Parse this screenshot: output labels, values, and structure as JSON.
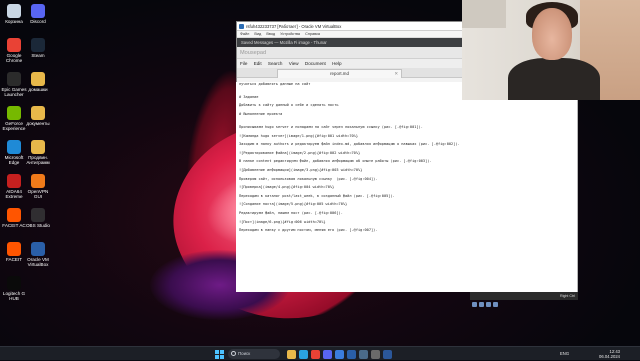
{
  "desktop_icons": [
    {
      "label": "Корзина",
      "color": "#c9d6e4"
    },
    {
      "label": "Discord",
      "color": "#5865f2"
    },
    {
      "label": "Google Chrome",
      "color": "#e94235"
    },
    {
      "label": "Steam",
      "color": "#1b2838"
    },
    {
      "label": "Epic Games Launcher",
      "color": "#2b2b2b"
    },
    {
      "label": "домашки",
      "color": "#e8b84a"
    },
    {
      "label": "GeForce Experience",
      "color": "#76b900"
    },
    {
      "label": "документы",
      "color": "#e8b84a"
    },
    {
      "label": "Microsoft Edge",
      "color": "#1f8ad6"
    },
    {
      "label": "Продвин. Антиграмм",
      "color": "#e8b84a"
    },
    {
      "label": "AIDA64 Extreme",
      "color": "#c6201f"
    },
    {
      "label": "OpenVPN GUI",
      "color": "#f07a1a"
    },
    {
      "label": "FACEIT AC",
      "color": "#ff5500"
    },
    {
      "label": "OBS Studio",
      "color": "#302e31"
    },
    {
      "label": "FACEIT",
      "color": "#ff5500"
    },
    {
      "label": "Oracle VM VirtualBox",
      "color": "#2a5fa8"
    },
    {
      "label": "Logitech G HUB",
      "color": "#0a0a0a"
    }
  ],
  "vbox": {
    "title": "rsfuh432233737 [Работает] - Oracle VM VirtualBox",
    "menu": [
      "Файл",
      "Вид",
      "Ввод",
      "Устройства",
      "Справка"
    ]
  },
  "xfce": {
    "left_text": "Saved Messages — Mozilla Fi image - Thunar",
    "right_text": "+3C ≋ 14:07 G  mv - [3/5] [983x56"
  },
  "editor": {
    "title": "Mousepad",
    "menu": [
      "File",
      "Edit",
      "Search",
      "View",
      "Document",
      "Help"
    ],
    "tab": "report.md",
    "lines": [
      "лучиться добавлять данные на сайт",
      "",
      "",
      "# Задание",
      "",
      "Добавить к сайту данный о себе и сделать пость",
      "",
      "# Выполнение проекта",
      "",
      "",
      "Прописываем hugo server и попадаем на сайт через локальную ссылку (рис. [-@fig:001]).",
      "",
      "![Команда hugo server](image/1.png){#fig:001 width=70%}",
      "",
      "Заходим в папку authors и редактируем файл index.md, добавляя информацию о навыках (рис. [-@fig:002]).",
      "",
      "![Редактирование файла](image/2.png){#fig:002 width=70%}",
      "",
      "В папке content редактируем файл, добавляя информацию об опыте работы (рис. [-@fig:003]).",
      "",
      "![Добавление информации](image/3.png){#fig:003 width=70%}",
      "",
      "Проверяю сайт, использовав локальную ссылку  (рис. [-@fig:004]).",
      "",
      "![Проверка](image/4.png){#fig:004 width=70%}",
      "",
      "Переходим в каталог post/last_week, в созданный файл (рис. [-@fig:005]).",
      "",
      "![Создание поста](image/5.png){#fig:005 width=70%}",
      "",
      "Редактируем файл, пишем пост (рис. [-@fig:006]).",
      "",
      "![Пост](image/6.png){#fig:006 width=70%}",
      "",
      "Переходим в папку с другим постом, меняю его (рис. [-@fig:007]).",
      ""
    ]
  },
  "vm_status": {
    "right": "Right Ctrl"
  },
  "taskbar": {
    "search_placeholder": "Поиск",
    "apps": [
      {
        "name": "file-explorer",
        "color": "#e8b84a"
      },
      {
        "name": "telegram",
        "color": "#2aa3e0"
      },
      {
        "name": "chrome",
        "color": "#e94235"
      },
      {
        "name": "discord",
        "color": "#5865f2"
      },
      {
        "name": "store",
        "color": "#3b7ddd"
      },
      {
        "name": "virtualbox",
        "color": "#2a5fa8"
      },
      {
        "name": "steam",
        "color": "#4a6b8a"
      },
      {
        "name": "obs",
        "color": "#6a6a6a"
      },
      {
        "name": "word",
        "color": "#2b579a"
      }
    ],
    "lang": "ENG",
    "time": "12:43",
    "date": "06.04.2024"
  }
}
